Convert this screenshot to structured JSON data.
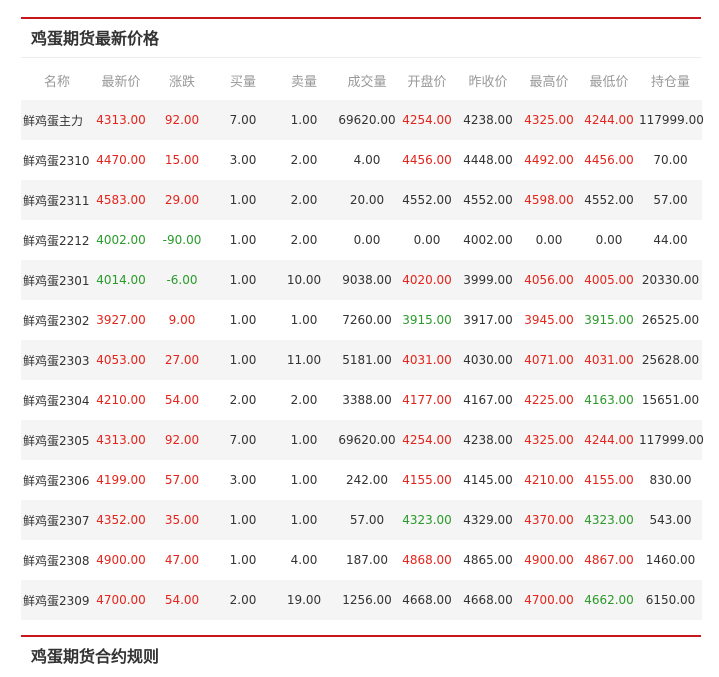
{
  "quote_panel": {
    "title": "鸡蛋期货最新价格",
    "columns": [
      "名称",
      "最新价",
      "涨跌",
      "买量",
      "卖量",
      "成交量",
      "开盘价",
      "昨收价",
      "最高价",
      "最低价",
      "持仓量"
    ],
    "rows": [
      {
        "name": "鲜鸡蛋主力",
        "last": "4313.00",
        "last_t": "up",
        "chg": "92.00",
        "chg_t": "up",
        "bid": "7.00",
        "ask": "1.00",
        "vol": "69620.00",
        "open": "4254.00",
        "open_t": "up",
        "prev": "4238.00",
        "high": "4325.00",
        "high_t": "up",
        "low": "4244.00",
        "low_t": "up",
        "oi": "117999.00"
      },
      {
        "name": "鲜鸡蛋2310",
        "last": "4470.00",
        "last_t": "up",
        "chg": "15.00",
        "chg_t": "up",
        "bid": "3.00",
        "ask": "2.00",
        "vol": "4.00",
        "open": "4456.00",
        "open_t": "up",
        "prev": "4448.00",
        "high": "4492.00",
        "high_t": "up",
        "low": "4456.00",
        "low_t": "up",
        "oi": "70.00"
      },
      {
        "name": "鲜鸡蛋2311",
        "last": "4583.00",
        "last_t": "up",
        "chg": "29.00",
        "chg_t": "up",
        "bid": "1.00",
        "ask": "2.00",
        "vol": "20.00",
        "open": "4552.00",
        "open_t": "flat",
        "prev": "4552.00",
        "high": "4598.00",
        "high_t": "up",
        "low": "4552.00",
        "low_t": "flat",
        "oi": "57.00"
      },
      {
        "name": "鲜鸡蛋2212",
        "last": "4002.00",
        "last_t": "down",
        "chg": "-90.00",
        "chg_t": "down",
        "bid": "1.00",
        "ask": "2.00",
        "vol": "0.00",
        "open": "0.00",
        "open_t": "flat",
        "prev": "4002.00",
        "high": "0.00",
        "high_t": "flat",
        "low": "0.00",
        "low_t": "flat",
        "oi": "44.00"
      },
      {
        "name": "鲜鸡蛋2301",
        "last": "4014.00",
        "last_t": "down",
        "chg": "-6.00",
        "chg_t": "down",
        "bid": "1.00",
        "ask": "10.00",
        "vol": "9038.00",
        "open": "4020.00",
        "open_t": "up",
        "prev": "3999.00",
        "high": "4056.00",
        "high_t": "up",
        "low": "4005.00",
        "low_t": "up",
        "oi": "20330.00"
      },
      {
        "name": "鲜鸡蛋2302",
        "last": "3927.00",
        "last_t": "up",
        "chg": "9.00",
        "chg_t": "up",
        "bid": "1.00",
        "ask": "1.00",
        "vol": "7260.00",
        "open": "3915.00",
        "open_t": "down",
        "prev": "3917.00",
        "high": "3945.00",
        "high_t": "up",
        "low": "3915.00",
        "low_t": "down",
        "oi": "26525.00"
      },
      {
        "name": "鲜鸡蛋2303",
        "last": "4053.00",
        "last_t": "up",
        "chg": "27.00",
        "chg_t": "up",
        "bid": "1.00",
        "ask": "11.00",
        "vol": "5181.00",
        "open": "4031.00",
        "open_t": "up",
        "prev": "4030.00",
        "high": "4071.00",
        "high_t": "up",
        "low": "4031.00",
        "low_t": "up",
        "oi": "25628.00"
      },
      {
        "name": "鲜鸡蛋2304",
        "last": "4210.00",
        "last_t": "up",
        "chg": "54.00",
        "chg_t": "up",
        "bid": "2.00",
        "ask": "2.00",
        "vol": "3388.00",
        "open": "4177.00",
        "open_t": "up",
        "prev": "4167.00",
        "high": "4225.00",
        "high_t": "up",
        "low": "4163.00",
        "low_t": "down",
        "oi": "15651.00"
      },
      {
        "name": "鲜鸡蛋2305",
        "last": "4313.00",
        "last_t": "up",
        "chg": "92.00",
        "chg_t": "up",
        "bid": "7.00",
        "ask": "1.00",
        "vol": "69620.00",
        "open": "4254.00",
        "open_t": "up",
        "prev": "4238.00",
        "high": "4325.00",
        "high_t": "up",
        "low": "4244.00",
        "low_t": "up",
        "oi": "117999.00"
      },
      {
        "name": "鲜鸡蛋2306",
        "last": "4199.00",
        "last_t": "up",
        "chg": "57.00",
        "chg_t": "up",
        "bid": "3.00",
        "ask": "1.00",
        "vol": "242.00",
        "open": "4155.00",
        "open_t": "up",
        "prev": "4145.00",
        "high": "4210.00",
        "high_t": "up",
        "low": "4155.00",
        "low_t": "up",
        "oi": "830.00"
      },
      {
        "name": "鲜鸡蛋2307",
        "last": "4352.00",
        "last_t": "up",
        "chg": "35.00",
        "chg_t": "up",
        "bid": "1.00",
        "ask": "1.00",
        "vol": "57.00",
        "open": "4323.00",
        "open_t": "down",
        "prev": "4329.00",
        "high": "4370.00",
        "high_t": "up",
        "low": "4323.00",
        "low_t": "down",
        "oi": "543.00"
      },
      {
        "name": "鲜鸡蛋2308",
        "last": "4900.00",
        "last_t": "up",
        "chg": "47.00",
        "chg_t": "up",
        "bid": "1.00",
        "ask": "4.00",
        "vol": "187.00",
        "open": "4868.00",
        "open_t": "up",
        "prev": "4865.00",
        "high": "4900.00",
        "high_t": "up",
        "low": "4867.00",
        "low_t": "up",
        "oi": "1460.00"
      },
      {
        "name": "鲜鸡蛋2309",
        "last": "4700.00",
        "last_t": "up",
        "chg": "54.00",
        "chg_t": "up",
        "bid": "2.00",
        "ask": "19.00",
        "vol": "1256.00",
        "open": "4668.00",
        "open_t": "flat",
        "prev": "4668.00",
        "high": "4700.00",
        "high_t": "up",
        "low": "4662.00",
        "low_t": "down",
        "oi": "6150.00"
      }
    ]
  },
  "rules_panel": {
    "title": "鸡蛋期货合约规则"
  },
  "colors": {
    "accent": "#c8161d",
    "up": "#e3241c",
    "down": "#2a9a2a",
    "row_stripe": "#f5f5f5"
  }
}
